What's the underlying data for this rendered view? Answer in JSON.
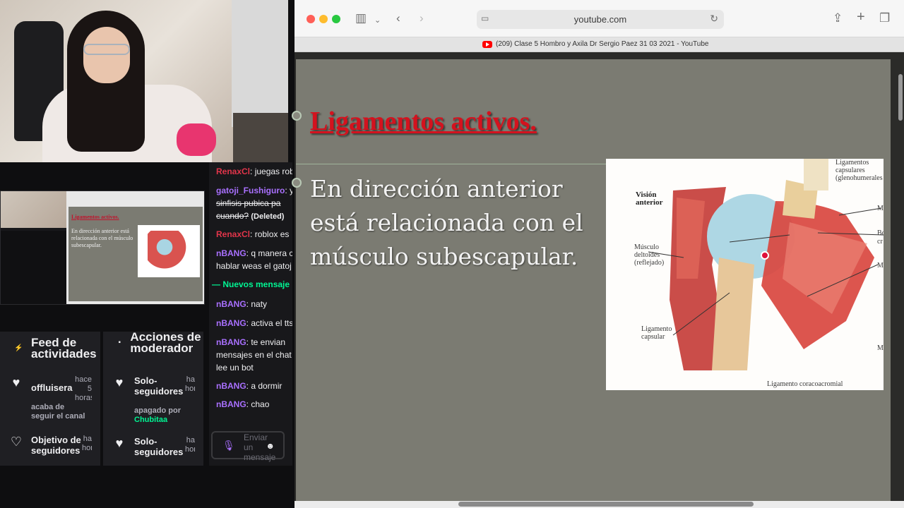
{
  "chat": {
    "messages": [
      {
        "user": "RenaxCl",
        "text": ": juegas rob",
        "color": "#e2354a"
      },
      {
        "user": "gatoji_Fushiguro",
        "text": ": y",
        "color": "#a970ff"
      },
      {
        "user": "",
        "text": "sinfisis pubica pa",
        "deleted_line": true
      },
      {
        "user": "",
        "text": "cuando?",
        "deleted_tag": "(Deleted)"
      },
      {
        "user": "RenaxCl",
        "text": ": roblox es",
        "color": "#e2354a"
      },
      {
        "user": "nBANG",
        "text": ": q manera c",
        "color": "#a970ff"
      },
      {
        "user": "",
        "text": "hablar weas el gatoj"
      },
      {
        "user": "nBANG",
        "text": ": naty",
        "color": "#a970ff"
      },
      {
        "user": "nBANG",
        "text": ": activa el tts",
        "color": "#a970ff"
      },
      {
        "user": "nBANG",
        "text": ": te envian",
        "color": "#a970ff"
      },
      {
        "user": "",
        "text": "mensajes en el chat"
      },
      {
        "user": "",
        "text": "lee un bot"
      },
      {
        "user": "nBANG",
        "text": ": a dormir",
        "color": "#a970ff"
      },
      {
        "user": "nBANG",
        "text": ": chao",
        "color": "#a970ff"
      }
    ],
    "new_messages_label": "— Nuevos mensaje",
    "input_placeholder": "Enviar un mensaje"
  },
  "activity_feed": {
    "title": "Feed de actividades",
    "items": [
      {
        "title": "offluisera",
        "time": "hace 5 horas",
        "subtitle": "acaba de seguir el canal"
      },
      {
        "title": "Objetivo de seguidores",
        "time": "ha hor",
        "subtitle": ""
      }
    ]
  },
  "mod_actions": {
    "title": "Acciones de moderador",
    "items": [
      {
        "title": "Solo-seguidores",
        "time": "ha hor",
        "subtitle": "apagado por",
        "actor": "Chubitaa"
      },
      {
        "title": "Solo-seguidores",
        "time": "ha hor",
        "subtitle": ""
      }
    ]
  },
  "mini_preview": {
    "slide_title": "Ligamentos activos.",
    "slide_text": "En dirección anterior está relacionada con el músculo subescapular."
  },
  "browser": {
    "url": "youtube.com",
    "tab_title": "(209) Clase 5 Hombro y Axila Dr Sergio Paez 31 03 2021 - YouTube"
  },
  "slide": {
    "title": "Ligamentos activos.",
    "body": "En dirección anterior está relacionada con el músculo subescapular.",
    "figure": {
      "label_view": "Visión anterior",
      "label_capsular": "Ligamentos capsulares (glenohumerales",
      "label_deltoid": "Músculo deltoides (reflejado)",
      "label_lig_capsular": "Ligamento capsular",
      "label_coraco": "Ligamento coracoacromial",
      "edge_labels": [
        "M",
        "Bo",
        "cr",
        "M",
        "M"
      ]
    }
  },
  "colors": {
    "twitch_bg": "#0e0e10",
    "panel_bg": "#1f1f23",
    "accent_purple": "#a970ff",
    "accent_green": "#00f593",
    "slide_title_red": "#d4121e",
    "slide_bg": "#7b7b72"
  }
}
